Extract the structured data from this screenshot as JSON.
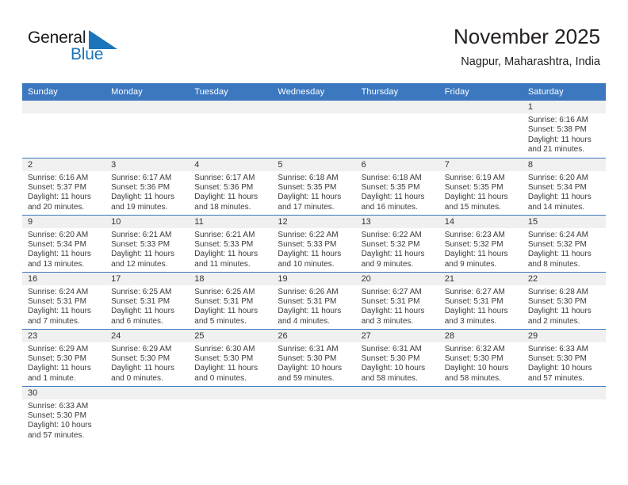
{
  "brand": {
    "name_part1": "General",
    "name_part2": "Blue",
    "flag_icon": "blue-flag-triangle",
    "colors": {
      "black": "#1a1a1a",
      "blue": "#1b75bb"
    }
  },
  "header": {
    "title": "November 2025",
    "subtitle": "Nagpur, Maharashtra, India"
  },
  "theme": {
    "header_blue": "#3b78c0",
    "daynum_gray": "#f0f0f0",
    "text": "#3b3b3b"
  },
  "weekday_headers": [
    "Sunday",
    "Monday",
    "Tuesday",
    "Wednesday",
    "Thursday",
    "Friday",
    "Saturday"
  ],
  "weeks": [
    [
      {
        "day": "",
        "empty": true
      },
      {
        "day": "",
        "empty": true
      },
      {
        "day": "",
        "empty": true
      },
      {
        "day": "",
        "empty": true
      },
      {
        "day": "",
        "empty": true
      },
      {
        "day": "",
        "empty": true
      },
      {
        "day": "1",
        "sunrise": "Sunrise: 6:16 AM",
        "sunset": "Sunset: 5:38 PM",
        "daylight": "Daylight: 11 hours and 21 minutes."
      }
    ],
    [
      {
        "day": "2",
        "sunrise": "Sunrise: 6:16 AM",
        "sunset": "Sunset: 5:37 PM",
        "daylight": "Daylight: 11 hours and 20 minutes."
      },
      {
        "day": "3",
        "sunrise": "Sunrise: 6:17 AM",
        "sunset": "Sunset: 5:36 PM",
        "daylight": "Daylight: 11 hours and 19 minutes."
      },
      {
        "day": "4",
        "sunrise": "Sunrise: 6:17 AM",
        "sunset": "Sunset: 5:36 PM",
        "daylight": "Daylight: 11 hours and 18 minutes."
      },
      {
        "day": "5",
        "sunrise": "Sunrise: 6:18 AM",
        "sunset": "Sunset: 5:35 PM",
        "daylight": "Daylight: 11 hours and 17 minutes."
      },
      {
        "day": "6",
        "sunrise": "Sunrise: 6:18 AM",
        "sunset": "Sunset: 5:35 PM",
        "daylight": "Daylight: 11 hours and 16 minutes."
      },
      {
        "day": "7",
        "sunrise": "Sunrise: 6:19 AM",
        "sunset": "Sunset: 5:35 PM",
        "daylight": "Daylight: 11 hours and 15 minutes."
      },
      {
        "day": "8",
        "sunrise": "Sunrise: 6:20 AM",
        "sunset": "Sunset: 5:34 PM",
        "daylight": "Daylight: 11 hours and 14 minutes."
      }
    ],
    [
      {
        "day": "9",
        "sunrise": "Sunrise: 6:20 AM",
        "sunset": "Sunset: 5:34 PM",
        "daylight": "Daylight: 11 hours and 13 minutes."
      },
      {
        "day": "10",
        "sunrise": "Sunrise: 6:21 AM",
        "sunset": "Sunset: 5:33 PM",
        "daylight": "Daylight: 11 hours and 12 minutes."
      },
      {
        "day": "11",
        "sunrise": "Sunrise: 6:21 AM",
        "sunset": "Sunset: 5:33 PM",
        "daylight": "Daylight: 11 hours and 11 minutes."
      },
      {
        "day": "12",
        "sunrise": "Sunrise: 6:22 AM",
        "sunset": "Sunset: 5:33 PM",
        "daylight": "Daylight: 11 hours and 10 minutes."
      },
      {
        "day": "13",
        "sunrise": "Sunrise: 6:22 AM",
        "sunset": "Sunset: 5:32 PM",
        "daylight": "Daylight: 11 hours and 9 minutes."
      },
      {
        "day": "14",
        "sunrise": "Sunrise: 6:23 AM",
        "sunset": "Sunset: 5:32 PM",
        "daylight": "Daylight: 11 hours and 9 minutes."
      },
      {
        "day": "15",
        "sunrise": "Sunrise: 6:24 AM",
        "sunset": "Sunset: 5:32 PM",
        "daylight": "Daylight: 11 hours and 8 minutes."
      }
    ],
    [
      {
        "day": "16",
        "sunrise": "Sunrise: 6:24 AM",
        "sunset": "Sunset: 5:31 PM",
        "daylight": "Daylight: 11 hours and 7 minutes."
      },
      {
        "day": "17",
        "sunrise": "Sunrise: 6:25 AM",
        "sunset": "Sunset: 5:31 PM",
        "daylight": "Daylight: 11 hours and 6 minutes."
      },
      {
        "day": "18",
        "sunrise": "Sunrise: 6:25 AM",
        "sunset": "Sunset: 5:31 PM",
        "daylight": "Daylight: 11 hours and 5 minutes."
      },
      {
        "day": "19",
        "sunrise": "Sunrise: 6:26 AM",
        "sunset": "Sunset: 5:31 PM",
        "daylight": "Daylight: 11 hours and 4 minutes."
      },
      {
        "day": "20",
        "sunrise": "Sunrise: 6:27 AM",
        "sunset": "Sunset: 5:31 PM",
        "daylight": "Daylight: 11 hours and 3 minutes."
      },
      {
        "day": "21",
        "sunrise": "Sunrise: 6:27 AM",
        "sunset": "Sunset: 5:31 PM",
        "daylight": "Daylight: 11 hours and 3 minutes."
      },
      {
        "day": "22",
        "sunrise": "Sunrise: 6:28 AM",
        "sunset": "Sunset: 5:30 PM",
        "daylight": "Daylight: 11 hours and 2 minutes."
      }
    ],
    [
      {
        "day": "23",
        "sunrise": "Sunrise: 6:29 AM",
        "sunset": "Sunset: 5:30 PM",
        "daylight": "Daylight: 11 hours and 1 minute."
      },
      {
        "day": "24",
        "sunrise": "Sunrise: 6:29 AM",
        "sunset": "Sunset: 5:30 PM",
        "daylight": "Daylight: 11 hours and 0 minutes."
      },
      {
        "day": "25",
        "sunrise": "Sunrise: 6:30 AM",
        "sunset": "Sunset: 5:30 PM",
        "daylight": "Daylight: 11 hours and 0 minutes."
      },
      {
        "day": "26",
        "sunrise": "Sunrise: 6:31 AM",
        "sunset": "Sunset: 5:30 PM",
        "daylight": "Daylight: 10 hours and 59 minutes."
      },
      {
        "day": "27",
        "sunrise": "Sunrise: 6:31 AM",
        "sunset": "Sunset: 5:30 PM",
        "daylight": "Daylight: 10 hours and 58 minutes."
      },
      {
        "day": "28",
        "sunrise": "Sunrise: 6:32 AM",
        "sunset": "Sunset: 5:30 PM",
        "daylight": "Daylight: 10 hours and 58 minutes."
      },
      {
        "day": "29",
        "sunrise": "Sunrise: 6:33 AM",
        "sunset": "Sunset: 5:30 PM",
        "daylight": "Daylight: 10 hours and 57 minutes."
      }
    ],
    [
      {
        "day": "30",
        "sunrise": "Sunrise: 6:33 AM",
        "sunset": "Sunset: 5:30 PM",
        "daylight": "Daylight: 10 hours and 57 minutes."
      },
      {
        "day": "",
        "empty": true
      },
      {
        "day": "",
        "empty": true
      },
      {
        "day": "",
        "empty": true
      },
      {
        "day": "",
        "empty": true
      },
      {
        "day": "",
        "empty": true
      },
      {
        "day": "",
        "empty": true
      }
    ]
  ]
}
